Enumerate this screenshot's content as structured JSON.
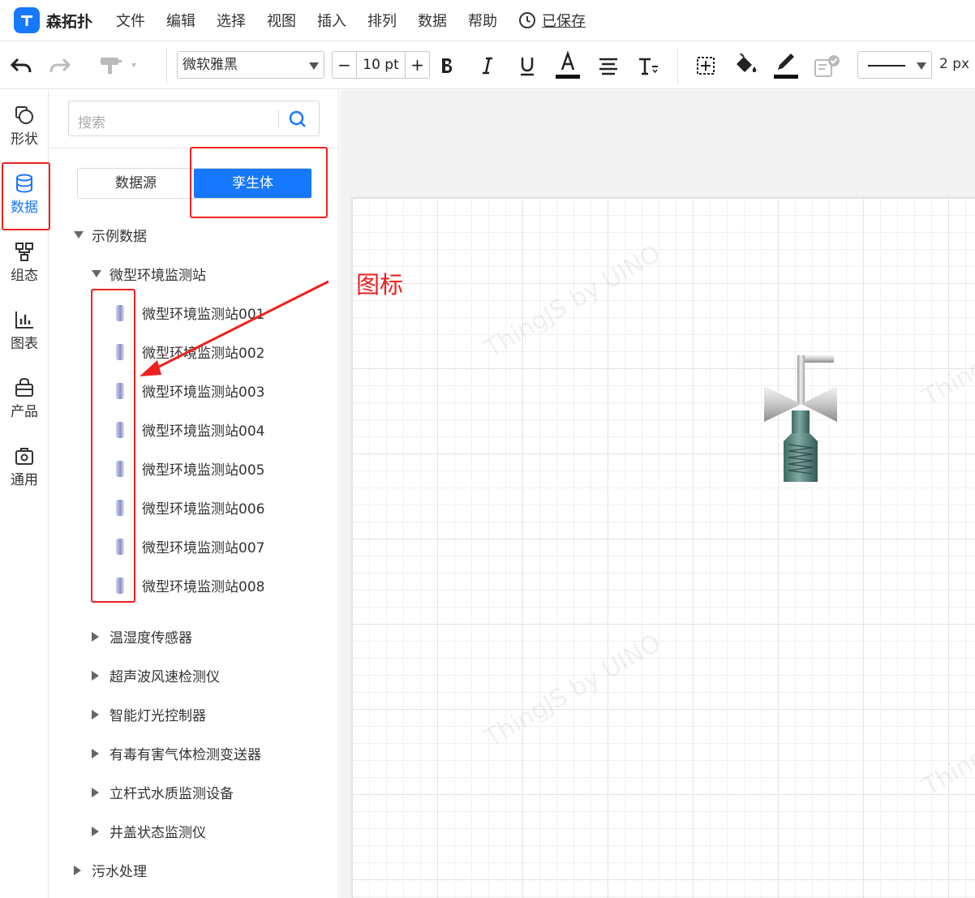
{
  "app": {
    "name": "森拓扑",
    "saved_label": "已保存"
  },
  "menu": [
    "文件",
    "编辑",
    "选择",
    "视图",
    "插入",
    "排列",
    "数据",
    "帮助"
  ],
  "toolbar": {
    "font": "微软雅黑",
    "font_size": "10 pt",
    "minus": "−",
    "plus": "+",
    "line_width": "2 px"
  },
  "rail": [
    {
      "label": "形状",
      "icon": "shapes-icon"
    },
    {
      "label": "数据",
      "icon": "database-icon",
      "active": true
    },
    {
      "label": "组态",
      "icon": "topology-icon"
    },
    {
      "label": "图表",
      "icon": "chart-icon"
    },
    {
      "label": "产品",
      "icon": "bag-icon"
    },
    {
      "label": "通用",
      "icon": "settings-box-icon"
    }
  ],
  "panel": {
    "search_placeholder": "搜索",
    "tab_datasource": "数据源",
    "tab_twin": "孪生体",
    "tree_root": "示例数据",
    "group_open": "微型环境监测站",
    "stations": [
      "微型环境监测站001",
      "微型环境监测站002",
      "微型环境监测站003",
      "微型环境监测站004",
      "微型环境监测站005",
      "微型环境监测站006",
      "微型环境监测站007",
      "微型环境监测站008"
    ],
    "groups_closed": [
      "温湿度传感器",
      "超声波风速检测仪",
      "智能灯光控制器",
      "有毒有害气体检测变送器",
      "立杆式水质监测设备",
      "井盖状态监测仪"
    ],
    "root2": "污水处理"
  },
  "annotation": "图标",
  "watermark": "ThingJS by UINO",
  "colors": {
    "accent": "#1677ff",
    "highlight": "#f02020"
  }
}
